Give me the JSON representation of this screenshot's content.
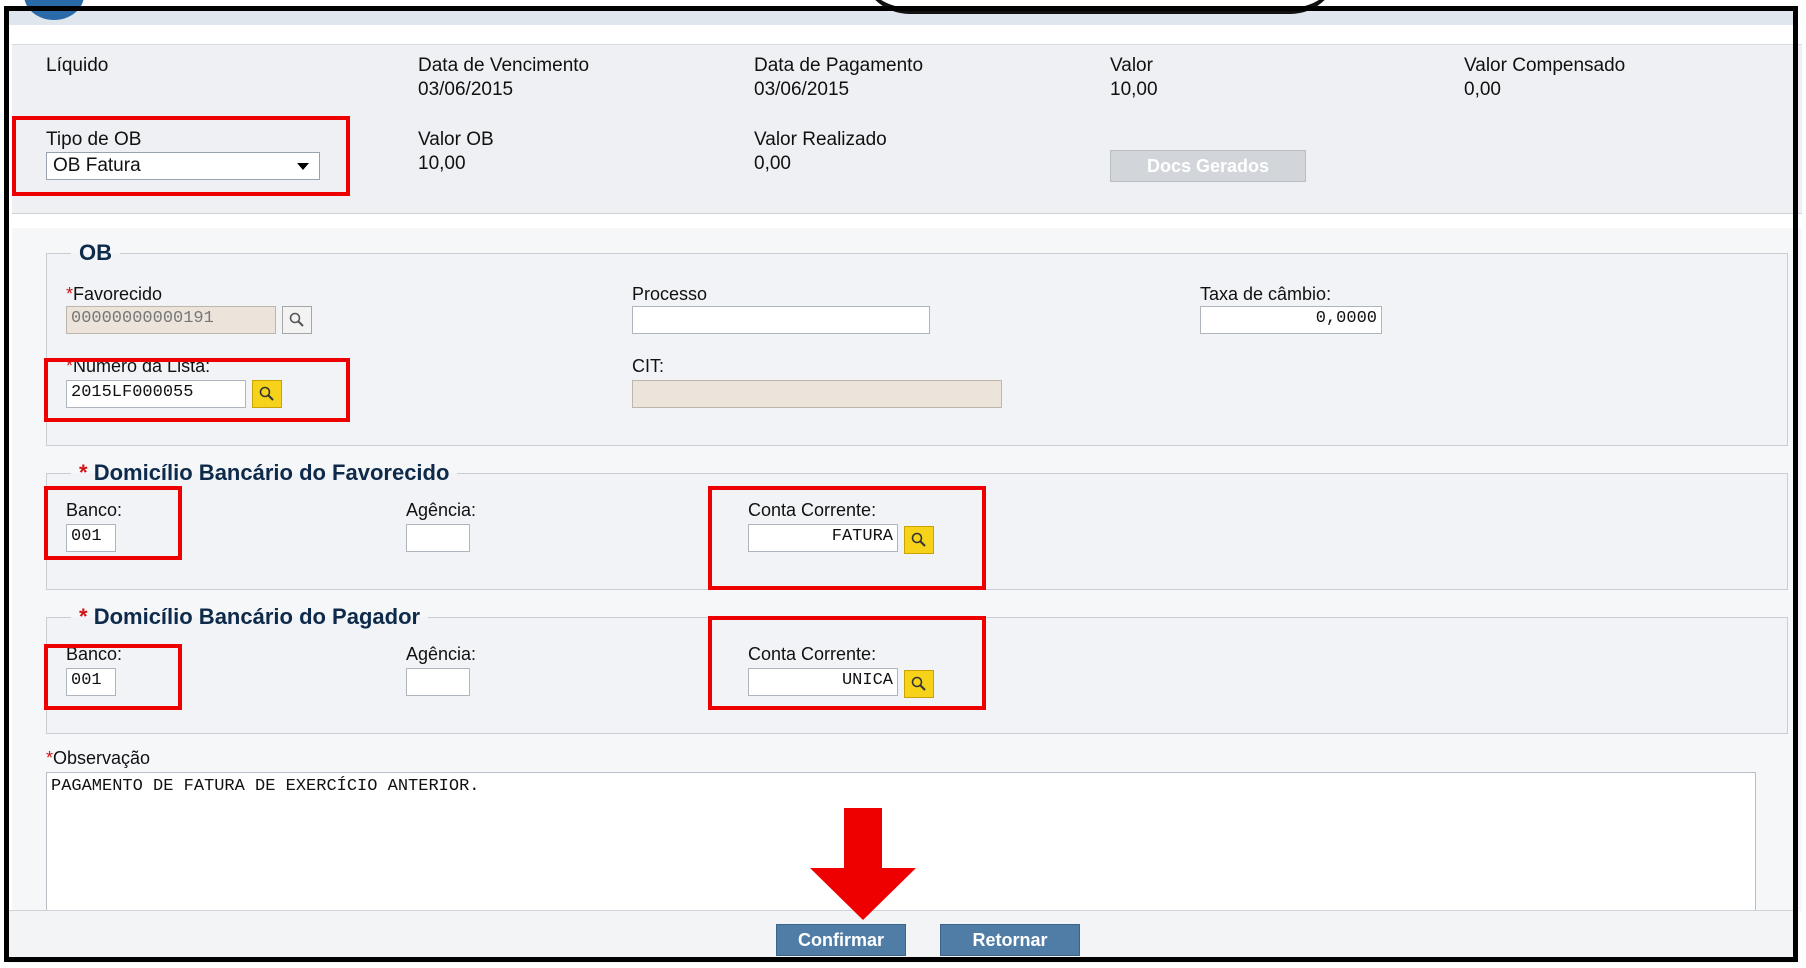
{
  "summary": {
    "liquido_label": "Líquido",
    "vencimento_label": "Data de Vencimento",
    "vencimento_value": "03/06/2015",
    "pagamento_label": "Data de Pagamento",
    "pagamento_value": "03/06/2015",
    "valor_label": "Valor",
    "valor_value": "10,00",
    "compensado_label": "Valor Compensado",
    "compensado_value": "0,00",
    "tipo_ob_label": "Tipo de OB",
    "tipo_ob_value": "OB Fatura",
    "valor_ob_label": "Valor OB",
    "valor_ob_value": "10,00",
    "realizado_label": "Valor Realizado",
    "realizado_value": "0,00",
    "docs_button": "Docs Gerados"
  },
  "ob": {
    "legend": "OB",
    "favorecido_label": "Favorecido",
    "favorecido_value": "00000000000191",
    "processo_label": "Processo",
    "processo_value": "",
    "taxa_label": "Taxa de câmbio:",
    "taxa_value": "0,0000",
    "numero_lista_label": "Numero da Lista:",
    "numero_lista_value": "2015LF000055",
    "cit_label": "CIT:",
    "cit_value": ""
  },
  "favorecido_domicilio": {
    "legend": "Domicílio Bancário do Favorecido",
    "banco_label": "Banco:",
    "banco_value": "001",
    "agencia_label": "Agência:",
    "agencia_value": "",
    "conta_label": "Conta Corrente:",
    "conta_value": "FATURA"
  },
  "pagador_domicilio": {
    "legend": "Domicílio Bancário do Pagador",
    "banco_label": "Banco:",
    "banco_value": "001",
    "agencia_label": "Agência:",
    "agencia_value": "",
    "conta_label": "Conta Corrente:",
    "conta_value": "UNICA"
  },
  "observacao": {
    "label": "Observação",
    "value": "PAGAMENTO DE FATURA DE EXERCÍCIO ANTERIOR."
  },
  "actions": {
    "confirm": "Confirmar",
    "back": "Retornar"
  },
  "required_mark": "*",
  "colors": {
    "annotation": "#ee0000",
    "button": "#4f7da6",
    "lookup": "#f6d31a",
    "legend_text": "#0e2a4a"
  },
  "icons": {
    "lookup": "magnifier-icon",
    "select": "chevron-down-icon",
    "annotation": "arrow-down-icon"
  }
}
